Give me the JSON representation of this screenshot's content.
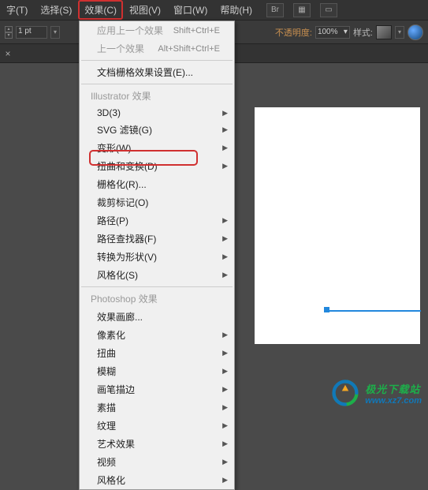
{
  "menubar": {
    "items": [
      "字(T)",
      "选择(S)",
      "效果(C)",
      "视图(V)",
      "窗口(W)",
      "帮助(H)"
    ],
    "icons": [
      "Br",
      "grid",
      "view"
    ]
  },
  "toolbar": {
    "stroke_value": "1 pt",
    "opacity_label": "不透明度:",
    "opacity_value": "100%",
    "style_label": "样式:"
  },
  "tabbar": {
    "close": "×"
  },
  "dropdown": {
    "r1": "应用上一个效果",
    "s1": "Shift+Ctrl+E",
    "r2": "上一个效果",
    "s2": "Alt+Shift+Ctrl+E",
    "r3": "文档栅格效果设置(E)...",
    "h1": "Illustrator 效果",
    "i1": "3D(3)",
    "i2": "SVG 滤镜(G)",
    "i3": "变形(W)",
    "i4": "扭曲和变换(D)",
    "i5": "栅格化(R)...",
    "i6": "裁剪标记(O)",
    "i7": "路径(P)",
    "i8": "路径查找器(F)",
    "i9": "转换为形状(V)",
    "i10": "风格化(S)",
    "h2": "Photoshop 效果",
    "p1": "效果画廊...",
    "p2": "像素化",
    "p3": "扭曲",
    "p4": "模糊",
    "p5": "画笔描边",
    "p6": "素描",
    "p7": "纹理",
    "p8": "艺术效果",
    "p9": "视频",
    "p10": "风格化"
  },
  "watermark": {
    "cn": "极光下载站",
    "url": "www.xz7.com"
  },
  "colors": {
    "highlight": "#d03030",
    "accent_orange": "#c99050",
    "line_blue": "#2288dd"
  }
}
